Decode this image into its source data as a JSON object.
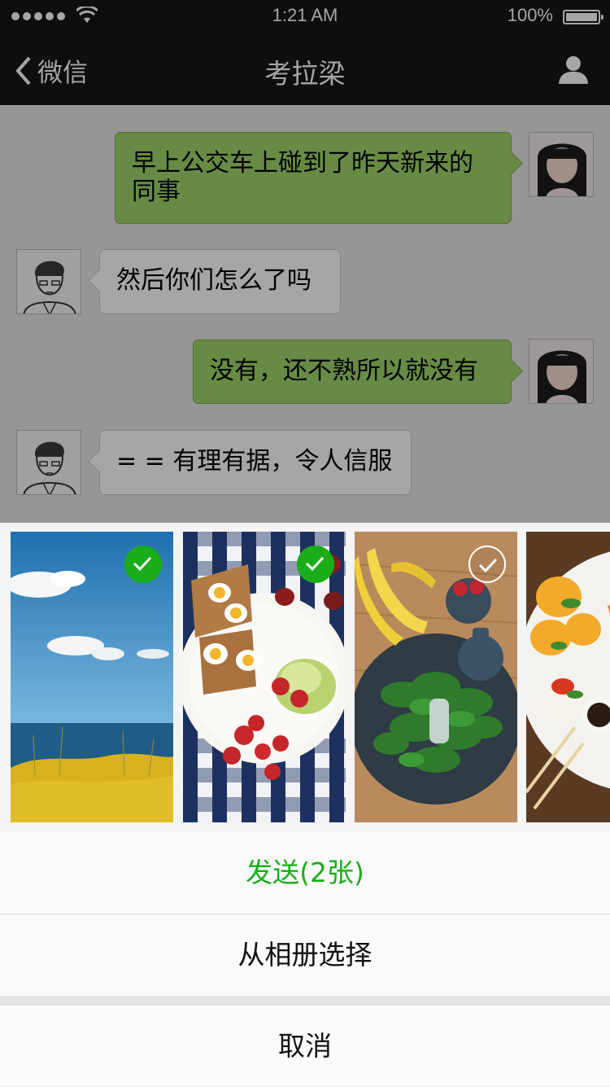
{
  "status_bar": {
    "time": "1:21 AM",
    "battery": "100%"
  },
  "nav": {
    "back_label": "微信",
    "title": "考拉梁"
  },
  "messages": [
    {
      "sender": "me",
      "text_line1": "早上公交车上碰到了昨天新来的",
      "text_line2": "同事"
    },
    {
      "sender": "other",
      "text": "然后你们怎么了吗"
    },
    {
      "sender": "me",
      "text": "没有，还不熟所以就没有"
    },
    {
      "sender": "other",
      "text": "= = 有理有据，令人信服"
    }
  ],
  "photos": [
    {
      "subject": "sea-and-sky",
      "selected": true
    },
    {
      "subject": "breakfast-plate",
      "selected": true
    },
    {
      "subject": "bananas-and-spinach",
      "selected": false
    },
    {
      "subject": "orange-slices-plate",
      "selected": false
    }
  ],
  "actions": {
    "send": "发送(2张)",
    "album": "从相册选择",
    "cancel": "取消"
  },
  "colors": {
    "accent": "#1aad19",
    "my_bubble": "#9fd66a",
    "bar": "#161616"
  }
}
